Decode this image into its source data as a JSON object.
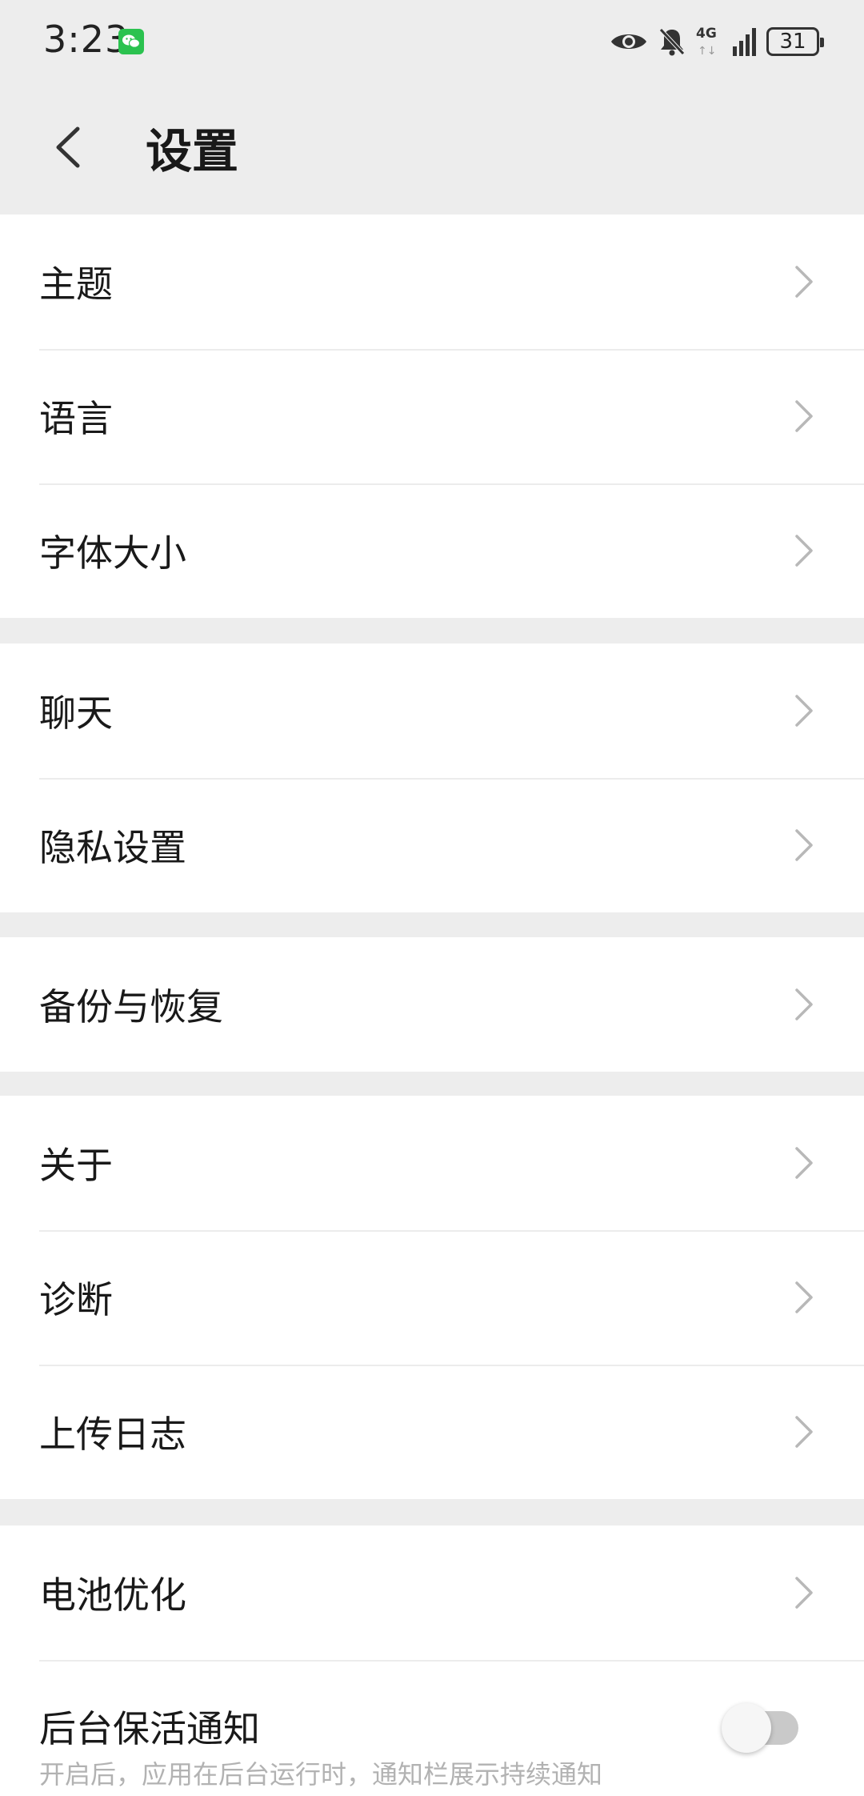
{
  "status_bar": {
    "time": "3:23",
    "network": "4G",
    "network_arrows": "↑↓",
    "battery": "31",
    "icons": [
      "wechat-notification-icon",
      "eye-icon",
      "bell-off-icon",
      "signal-icon",
      "battery-icon"
    ]
  },
  "header": {
    "title": "设置",
    "back_icon": "chevron-left-icon"
  },
  "groups": [
    {
      "items": [
        {
          "label": "主题"
        },
        {
          "label": "语言"
        },
        {
          "label": "字体大小"
        }
      ]
    },
    {
      "items": [
        {
          "label": "聊天"
        },
        {
          "label": "隐私设置"
        }
      ]
    },
    {
      "items": [
        {
          "label": "备份与恢复"
        }
      ]
    },
    {
      "items": [
        {
          "label": "关于"
        },
        {
          "label": "诊断"
        },
        {
          "label": "上传日志"
        }
      ]
    },
    {
      "items": [
        {
          "label": "电池优化"
        },
        {
          "label": "后台保活通知",
          "description": "开启后，应用在后台运行时，通知栏展示持续通知",
          "toggle_on": false
        }
      ]
    }
  ],
  "colors": {
    "background": "#ededed",
    "card": "#ffffff",
    "text_primary": "#191919",
    "text_secondary": "#b2b2b2",
    "chevron": "#b8b8b8",
    "wechat_green": "#2bc24f"
  }
}
